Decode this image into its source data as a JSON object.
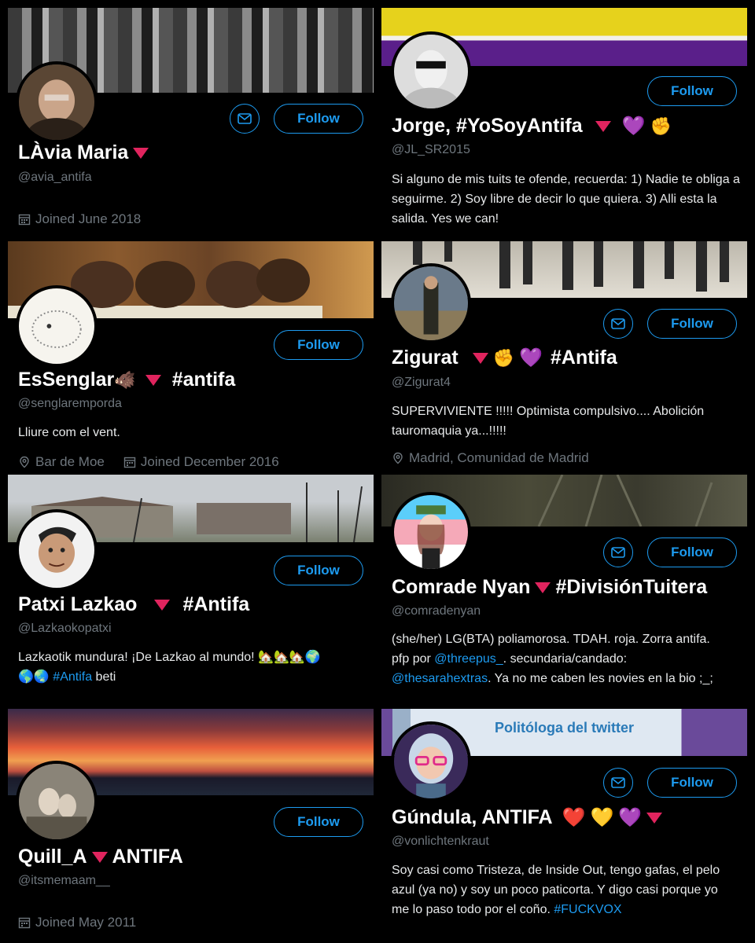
{
  "colors": {
    "accent": "#1d9bf0",
    "muted": "#6e767d",
    "background": "#000000",
    "triangle": "#e0245e"
  },
  "cards": [
    {
      "name": "L'Àvia Maria",
      "name_text": "LÀvia Maria",
      "handle": "@avia_antifa",
      "follow_label": "Follow",
      "joined": "Joined June 2018"
    },
    {
      "name_text": "Jorge, #YoSoyAntifa",
      "handle": "@JL_SR2015",
      "follow_label": "Follow",
      "bio": "Si alguno de mis tuits te ofende, recuerda:  1) Nadie te obliga a seguirme. 2) Soy libre de decir lo que quiera.  3) Alli esta la salida. Yes we can!",
      "emoji_heart": "💜",
      "emoji_fist": "✊"
    },
    {
      "name_text": "EsSenglar",
      "name_tag": "#antifa",
      "emoji_boar": "🐗",
      "handle": "@senglaremporda",
      "follow_label": "Follow",
      "bio": "Lliure com el vent.",
      "location": "Bar de Moe",
      "joined": "Joined December 2016"
    },
    {
      "name_text": "Zigurat",
      "name_tag": "#Antifa",
      "emoji_fist": "✊",
      "emoji_heart": "💜",
      "handle": "@Zigurat4",
      "follow_label": "Follow",
      "bio": "SUPERVIVIENTE !!!!!  Optimista compulsivo.... Abolición tauromaquia ya...!!!!!",
      "location": "Madrid, Comunidad de Madrid"
    },
    {
      "name_text": "Patxi Lazkao",
      "name_tag": "#Antifa",
      "handle": "@Lazkaokopatxi",
      "follow_label": "Follow",
      "bio_a": "Lazkaotik mundura!  ¡De Lazkao al mundo! 🏡🏡🏡🌍",
      "bio_b": "🌎🌏 ",
      "bio_link": "#Antifa",
      "bio_c": " beti"
    },
    {
      "name_text": "Comrade Nyan",
      "name_tag": "#DivisiónTuitera",
      "handle": "@comradenyan",
      "follow_label": "Follow",
      "bio_a": "(she/her) LG(BTA) poliamorosa. TDAH. roja. Zorra antifa. pfp por ",
      "bio_link1": "@threepus_",
      "bio_b": ". secundaria/candado: ",
      "bio_link2": "@thesarahextras",
      "bio_c": ". Ya no me caben les novies en la bio ;_;"
    },
    {
      "name_text": "Quill_A",
      "name_tag": "ANTIFA",
      "handle": "@itsmemaam__",
      "follow_label": "Follow",
      "joined": "Joined May 2011"
    },
    {
      "name_text": "Gúndula, ANTIFA",
      "emoji_red_heart": "❤️",
      "emoji_yellow_heart": "💛",
      "emoji_purple_heart": "💜",
      "handle": "@vonlichtenkraut",
      "follow_label": "Follow",
      "bio_a": "Soy casi como Tristeza, de Inside Out, tengo gafas, el pelo azul (ya no) y soy un poco paticorta. Y digo casi porque yo me lo paso todo por el coño. ",
      "bio_link": "#FUCKVOX",
      "banner_text": "Politóloga del twitter"
    }
  ]
}
